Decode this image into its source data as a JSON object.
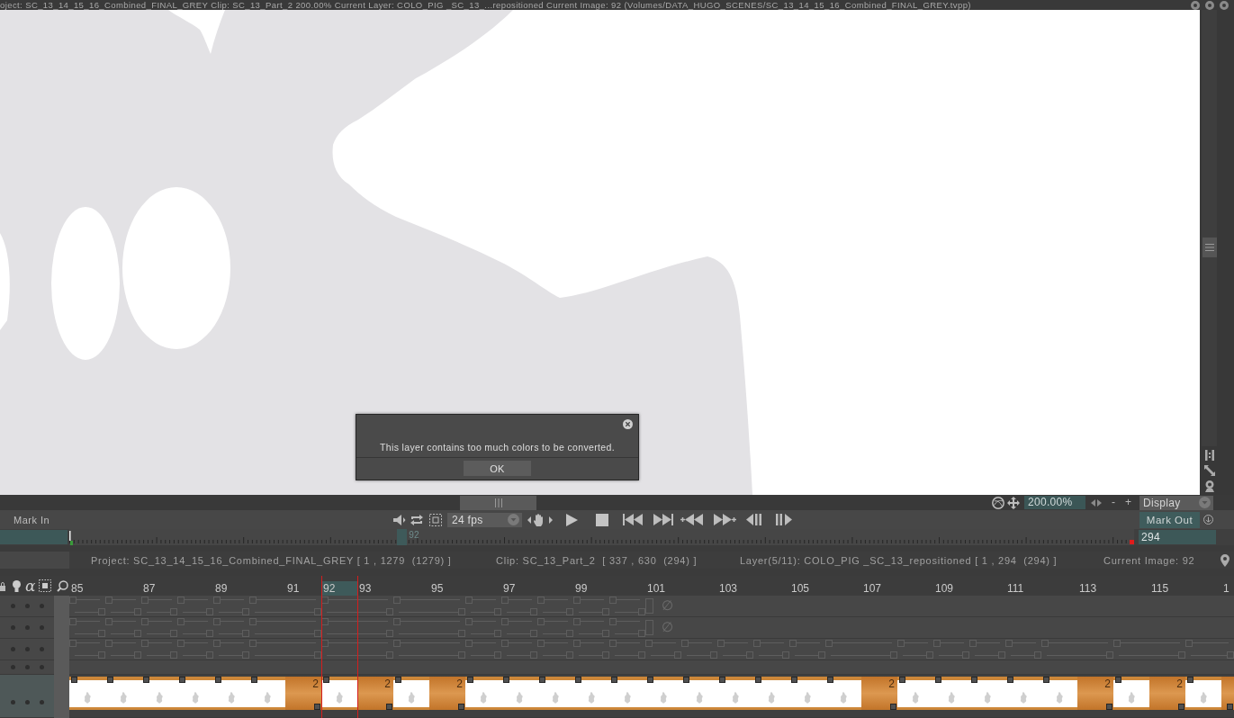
{
  "window": {
    "title": "oject: SC_13_14_15_16_Combined_FINAL_GREY Clip: SC_13_Part_2 200.00% Current Layer: COLO_PIG _SC_13_...repositioned Current Image: 92 (Volumes/DATA_HUGO_SCENES/SC_13_14_15_16_Combined_FINAL_GREY.tvpp)"
  },
  "dialog": {
    "message": "This layer contains too much colors to be converted.",
    "buttons": [
      "OK"
    ]
  },
  "view_bar": {
    "zoom": "200.00%",
    "zoom_out": "-",
    "zoom_in": "+",
    "display": "Display"
  },
  "transport": {
    "mark_in": "Mark In",
    "fps": "24 fps",
    "mark_out": "Mark Out"
  },
  "ruler": {
    "playhead": {
      "label": "92",
      "level": 0.308
    },
    "mark_out_field": "294"
  },
  "status_bar": [
    "Project: SC_13_14_15_16_Combined_FINAL_GREY [ 1 , 1279  (1279) ]",
    "Clip: SC_13_Part_2  [ 337 , 630  (294) ]",
    "Layer(5/11): COLO_PIG _SC_13_repositioned [ 1 , 294  (294) ]",
    "Current Image: 92"
  ],
  "timeline": {
    "alpha_toggle": "α",
    "frames": [
      {
        "label": "85",
        "selected": false
      },
      {
        "selected": false
      },
      {
        "label": "87",
        "selected": false
      },
      {
        "selected": false
      },
      {
        "label": "89",
        "selected": false
      },
      {
        "selected": false
      },
      {
        "label": "91",
        "selected": false
      },
      {
        "label": "92",
        "selected": true
      },
      {
        "label": "93",
        "selected": false
      },
      {
        "selected": false
      },
      {
        "label": "95",
        "selected": false
      },
      {
        "selected": false
      },
      {
        "label": "97",
        "selected": false
      },
      {
        "selected": false
      },
      {
        "label": "99",
        "selected": false
      },
      {
        "selected": false
      },
      {
        "label": "101",
        "selected": false
      },
      {
        "selected": false
      },
      {
        "label": "103",
        "selected": false
      },
      {
        "selected": false
      },
      {
        "label": "105",
        "selected": false
      },
      {
        "selected": false
      },
      {
        "label": "107",
        "selected": false
      },
      {
        "selected": false
      },
      {
        "label": "109",
        "selected": false
      },
      {
        "selected": false
      },
      {
        "label": "111",
        "selected": false
      },
      {
        "selected": false
      },
      {
        "label": "113",
        "selected": false
      },
      {
        "selected": false
      },
      {
        "label": "115",
        "selected": false
      },
      {
        "selected": false
      },
      {
        "label": "1",
        "selected": false
      }
    ],
    "layers": [
      {
        "kind": "exposures",
        "selected": false,
        "exposures": [
          {
            "kind": "single"
          },
          {
            "kind": "single"
          },
          {
            "kind": "single"
          },
          {
            "kind": "single"
          },
          {
            "kind": "single"
          },
          {
            "kind": "double"
          },
          {
            "kind": "double"
          },
          {
            "kind": "double"
          },
          {
            "kind": "single"
          },
          {
            "kind": "single"
          },
          {
            "kind": "single"
          },
          {
            "kind": "single"
          },
          {
            "kind": "single"
          }
        ],
        "end_mark": "∅"
      },
      {
        "kind": "exposures",
        "selected": false,
        "exposures": [
          {
            "kind": "single"
          },
          {
            "kind": "single"
          },
          {
            "kind": "single"
          },
          {
            "kind": "single"
          },
          {
            "kind": "single"
          },
          {
            "kind": "double"
          },
          {
            "kind": "double"
          },
          {
            "kind": "double"
          },
          {
            "kind": "single"
          },
          {
            "kind": "single"
          },
          {
            "kind": "single"
          },
          {
            "kind": "single"
          },
          {
            "kind": "single"
          }
        ],
        "end_mark": "∅"
      },
      {
        "kind": "exposures",
        "selected": false,
        "exposures": [
          {
            "kind": "single"
          },
          {
            "kind": "single"
          },
          {
            "kind": "single"
          },
          {
            "kind": "single"
          },
          {
            "kind": "single"
          },
          {
            "kind": "double"
          },
          {
            "kind": "double"
          },
          {
            "kind": "double"
          },
          {
            "kind": "single"
          },
          {
            "kind": "single"
          },
          {
            "kind": "single"
          },
          {
            "kind": "single"
          },
          {
            "kind": "single"
          },
          {
            "kind": "single"
          },
          {
            "kind": "single"
          },
          {
            "kind": "single"
          },
          {
            "kind": "single"
          },
          {
            "kind": "single"
          },
          {
            "kind": "double"
          },
          {
            "kind": "single"
          },
          {
            "kind": "single"
          },
          {
            "kind": "single"
          },
          {
            "kind": "single"
          },
          {
            "kind": "double"
          },
          {
            "kind": "double"
          },
          {
            "kind": "double"
          }
        ]
      },
      {
        "kind": "blank",
        "selected": false
      },
      {
        "kind": "filmstrip",
        "selected": true,
        "exposures": [
          {
            "kind": "single"
          },
          {
            "kind": "single"
          },
          {
            "kind": "single"
          },
          {
            "kind": "single"
          },
          {
            "kind": "single"
          },
          {
            "kind": "double",
            "label": "2"
          },
          {
            "kind": "double",
            "label": "2"
          },
          {
            "kind": "double",
            "label": "2"
          },
          {
            "kind": "single"
          },
          {
            "kind": "single"
          },
          {
            "kind": "single"
          },
          {
            "kind": "single"
          },
          {
            "kind": "single"
          },
          {
            "kind": "single"
          },
          {
            "kind": "single"
          },
          {
            "kind": "single"
          },
          {
            "kind": "single"
          },
          {
            "kind": "single"
          },
          {
            "kind": "double",
            "label": "2"
          },
          {
            "kind": "single"
          },
          {
            "kind": "single"
          },
          {
            "kind": "single"
          },
          {
            "kind": "single"
          },
          {
            "kind": "double",
            "label": "2"
          },
          {
            "kind": "double",
            "label": "2"
          },
          {
            "kind": "double"
          }
        ]
      }
    ]
  }
}
